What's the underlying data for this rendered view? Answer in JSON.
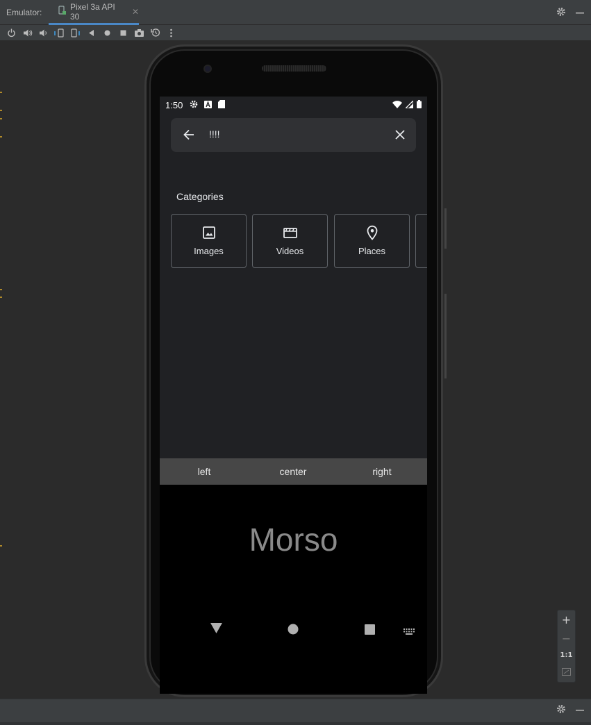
{
  "window": {
    "panel_label": "Emulator:",
    "tab_label": "Pixel 3a API 30",
    "icons": [
      "settings-icon",
      "minimize-icon",
      "close-icon",
      "device-icon"
    ]
  },
  "toolbar": {
    "icons": [
      "power-icon",
      "volume-up-icon",
      "volume-down-icon",
      "rotate-left-icon",
      "rotate-right-icon",
      "back-icon",
      "home-icon",
      "overview-icon",
      "screenshot-icon",
      "snapshot-icon",
      "more-icon"
    ]
  },
  "status_bar": {
    "time": "1:50",
    "icons": [
      "settings-icon",
      "a-icon",
      "sd-card-icon",
      "wifi-icon",
      "signal-icon",
      "battery-icon"
    ]
  },
  "search": {
    "query": "!!!!",
    "icons": [
      "back-arrow-icon",
      "clear-icon"
    ]
  },
  "categories": {
    "title": "Categories",
    "items": [
      {
        "label": "Images",
        "icon": "image-icon"
      },
      {
        "label": "Videos",
        "icon": "video-icon"
      },
      {
        "label": "Places",
        "icon": "place-icon"
      }
    ]
  },
  "alignment": {
    "left": "left",
    "center": "center",
    "right": "right"
  },
  "keyboard": {
    "brand": "Morso"
  },
  "navbar": {
    "icons": [
      "back-triangle-icon",
      "home-circle-icon",
      "recents-square-icon",
      "keyboard-icon"
    ]
  },
  "zoom": {
    "zoom_in": "+",
    "zoom_out": "−",
    "actual_size": "1:1",
    "fit_icon": "fit-screen-icon"
  },
  "colors": {
    "ide_background": "#2b2b2b",
    "ide_panel": "#3c3f41",
    "app_background": "#202124",
    "search_background": "#303134",
    "alignment_bar": "#474747",
    "tab_accent": "#4a88c7"
  }
}
